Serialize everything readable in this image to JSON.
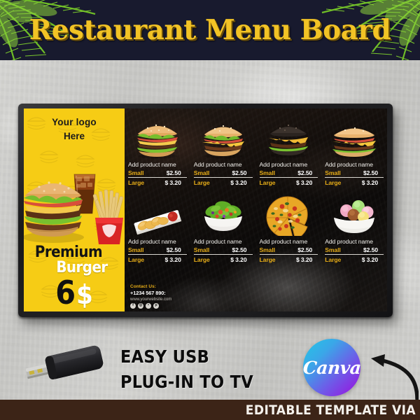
{
  "header": {
    "title": "Restaurant Menu Board",
    "bg_color": "#181a2e",
    "title_color": "#f2c325",
    "decoration_left": "palm-leaf",
    "decoration_right": "palm-leaf"
  },
  "tv": {
    "frame_color": "#1a1a1c",
    "screen_bg": "#120f0d"
  },
  "promo": {
    "panel_color": "#f6cc15",
    "logo_line1": "Your logo",
    "logo_line2": "Here",
    "product_line1": "Premium",
    "product_line2": "Burger",
    "price_number": "6",
    "price_currency": "$",
    "image": "burger-fries-cola",
    "pattern": "burger-outline-pattern"
  },
  "menu": {
    "rows": [
      {
        "items": [
          {
            "image": "burger-lettuce-tomato",
            "name": "Add product name",
            "sizes": [
              {
                "label": "Small",
                "price": "$2.50"
              },
              {
                "label": "Large",
                "price": "$ 3.20"
              }
            ]
          },
          {
            "image": "cheeseburger",
            "name": "Add product name",
            "sizes": [
              {
                "label": "Small",
                "price": "$2.50"
              },
              {
                "label": "Large",
                "price": "$ 3.20"
              }
            ]
          },
          {
            "image": "black-bun-burger",
            "name": "Add product name",
            "sizes": [
              {
                "label": "Small",
                "price": "$2.50"
              },
              {
                "label": "Large",
                "price": "$ 3.20"
              }
            ]
          },
          {
            "image": "classic-burger",
            "name": "Add product name",
            "sizes": [
              {
                "label": "Small",
                "price": "$2.50"
              },
              {
                "label": "Large",
                "price": "$ 3.20"
              }
            ]
          }
        ]
      },
      {
        "items": [
          {
            "image": "chicken-nuggets-ketchup",
            "name": "Add product name",
            "sizes": [
              {
                "label": "Small",
                "price": "$2.50"
              },
              {
                "label": "Large",
                "price": "$ 3.20"
              }
            ]
          },
          {
            "image": "garden-salad-bowl",
            "name": "Add product name",
            "sizes": [
              {
                "label": "Small",
                "price": "$2.50"
              },
              {
                "label": "Large",
                "price": "$ 3.20"
              }
            ]
          },
          {
            "image": "pizza-sliced",
            "name": "Add product name",
            "sizes": [
              {
                "label": "Small",
                "price": "$2.50"
              },
              {
                "label": "Large",
                "price": "$ 3.20"
              }
            ]
          },
          {
            "image": "ice-cream-scoops-bowl",
            "name": "Add product name",
            "sizes": [
              {
                "label": "Small",
                "price": "$2.50"
              },
              {
                "label": "Large",
                "price": "$ 3.20"
              }
            ]
          }
        ]
      }
    ],
    "label_color": "#e8ae18",
    "price_color": "#ffffff"
  },
  "contact": {
    "heading": "Contact Us:",
    "phone": "+1234 567 890:",
    "website": "www.yourwebsite.com",
    "social": [
      {
        "name": "facebook-icon",
        "glyph": "f"
      },
      {
        "name": "instagram-icon",
        "glyph": "◎"
      },
      {
        "name": "twitter-icon",
        "glyph": "•"
      },
      {
        "name": "pinterest-icon",
        "glyph": "p"
      }
    ]
  },
  "promo_bottom": {
    "usb_line1": "EASY USB",
    "usb_line2": "PLUG-IN TO TV",
    "usb_image": "usb-flash-drive",
    "canva_label": "Canva",
    "canva_gradient_from": "#22c7e6",
    "canva_gradient_to": "#8a2be2",
    "arrow": "curved-arrow-left",
    "bar_text": "EDITABLE TEMPLATE VIA",
    "bar_color": "#3c2417"
  }
}
